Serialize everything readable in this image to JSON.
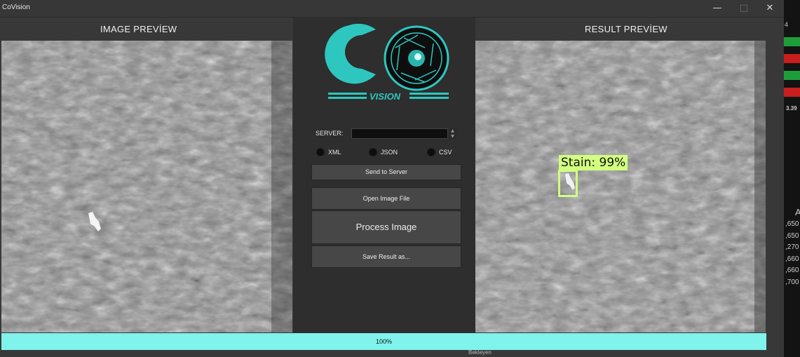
{
  "window": {
    "title": "CoVision",
    "minimize_icon": "minimize-icon",
    "maximize_icon": "maximize-icon",
    "close_icon": "close-icon"
  },
  "panels": {
    "image_preview_title": "IMAGE PREVİEW",
    "result_preview_title": "RESULT PREVİEW"
  },
  "logo": {
    "text": "VISION",
    "accent_color": "#2ec7c0"
  },
  "server": {
    "label": "SERVER:",
    "value": ""
  },
  "formats": [
    "XML",
    "JSON",
    "CSV"
  ],
  "buttons": {
    "send": "Send to Server",
    "open": "Open Image File",
    "process": "Process Image",
    "save": "Save Result as..."
  },
  "detection": {
    "label": "Stain: 99%",
    "box_color": "#d2ff7f"
  },
  "progress": {
    "value": 100,
    "text": "100%",
    "color": "#7ff3ec"
  },
  "background_app": {
    "top_number": "4",
    "price": "3.39",
    "values": [
      ",650",
      ",650",
      ",270",
      ",660",
      ",660",
      ",700"
    ],
    "header_letter": "A",
    "bottom_text": "Bekleyen"
  }
}
